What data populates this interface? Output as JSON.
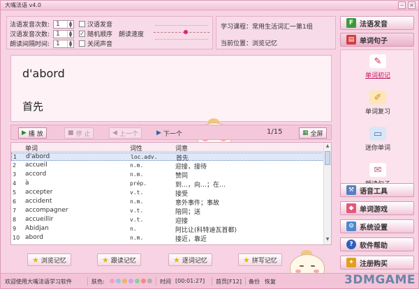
{
  "window": {
    "title": "大嘴法语 v4.0"
  },
  "settings": {
    "rows": [
      {
        "label": "法语发音次数:",
        "value": "1"
      },
      {
        "label": "汉语发音次数:",
        "value": "1"
      },
      {
        "label": "朗读间隔时间:",
        "value": "1"
      }
    ],
    "checkboxes": [
      {
        "label": "汉语发音",
        "checked": false
      },
      {
        "label": "随机顺序",
        "checked": true
      },
      {
        "label": "关闭声音",
        "checked": false
      }
    ],
    "speed_label": "朗读速度"
  },
  "course": {
    "line1": "学习课程：常用生活词汇一第1组",
    "line2": "当前位置：浏览记忆"
  },
  "current": {
    "word": "d'abord",
    "meaning": "首先"
  },
  "controls": {
    "play": "播 放",
    "stop": "停 止",
    "prev": "上一个",
    "next": "下一个",
    "counter": "1/15",
    "fullscreen": "全屏"
  },
  "table": {
    "headers": {
      "word": "单词",
      "pos": "词性",
      "meaning": "词意"
    },
    "rows": [
      {
        "n": "1",
        "word": "d'abord",
        "pos": "loc.adv.",
        "meaning": "首先"
      },
      {
        "n": "2",
        "word": "accueil",
        "pos": "n.m.",
        "meaning": "迎接，接待"
      },
      {
        "n": "3",
        "word": "accord",
        "pos": "n.m.",
        "meaning": "赞同"
      },
      {
        "n": "4",
        "word": "à",
        "pos": "prép.",
        "meaning": "到…，向…；在…"
      },
      {
        "n": "5",
        "word": "accepter",
        "pos": "v.t.",
        "meaning": "接受"
      },
      {
        "n": "6",
        "word": "accident",
        "pos": "n.m.",
        "meaning": "意外事件；事故"
      },
      {
        "n": "7",
        "word": "accompagner",
        "pos": "v.t.",
        "meaning": "陪同；送"
      },
      {
        "n": "8",
        "word": "accueillir",
        "pos": "v.t.",
        "meaning": "迎接"
      },
      {
        "n": "9",
        "word": "Abidjan",
        "pos": "n.",
        "meaning": "阿比让(科特迪瓦首都)"
      },
      {
        "n": "10",
        "word": "abord",
        "pos": "n.m.",
        "meaning": "接近，靠近"
      }
    ]
  },
  "modes": [
    "浏览记忆",
    "跟读记忆",
    "逐词记忆",
    "拼写记忆"
  ],
  "sidebar": {
    "top": [
      {
        "label": "法语发音",
        "icon": "F"
      },
      {
        "label": "单词句子",
        "icon": "book"
      }
    ],
    "sub": [
      {
        "label": "单词初记"
      },
      {
        "label": "单词复习"
      },
      {
        "label": "迷你单词"
      },
      {
        "label": "朗读句子"
      }
    ],
    "bottom": [
      {
        "label": "语音工具"
      },
      {
        "label": "单词游戏"
      },
      {
        "label": "系统设置"
      },
      {
        "label": "软件帮助"
      },
      {
        "label": "注册购买"
      }
    ]
  },
  "status": {
    "welcome": "欢迎使用大嘴法语学习软件",
    "skin_label": "肤色:",
    "skin_colors": [
      "#f5a0c0",
      "#9bc2e8",
      "#f3b06a",
      "#c7a7e8",
      "#8fd18f",
      "#f08a8a",
      "#b0b0b0"
    ],
    "time_label": "时间",
    "time_value": "[00:01:27]",
    "home": "首页[F12]",
    "backup": "备份",
    "restore": "恢复"
  },
  "watermark": "3DMGAME"
}
